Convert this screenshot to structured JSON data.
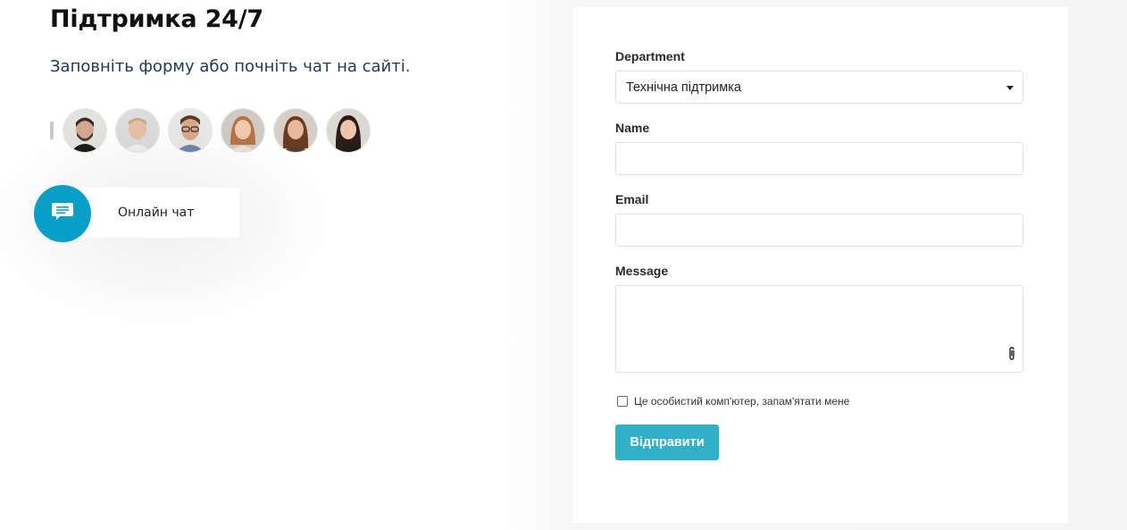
{
  "support": {
    "title": "Підтримка 24/7",
    "subtitle": "Заповніть форму або почніть чат на сайті."
  },
  "chat_widget": {
    "label": "Онлайн чат",
    "icon": "chat-icon",
    "color": "#0a9fc6"
  },
  "avatars": [
    {
      "name": "avatar-agent-1"
    },
    {
      "name": "avatar-agent-2"
    },
    {
      "name": "avatar-agent-3"
    },
    {
      "name": "avatar-agent-4"
    },
    {
      "name": "avatar-agent-5"
    },
    {
      "name": "avatar-agent-6"
    }
  ],
  "form": {
    "department_label": "Department",
    "department_value": "Технічна підтримка",
    "name_label": "Name",
    "name_value": "",
    "email_label": "Email",
    "email_value": "",
    "message_label": "Message",
    "message_value": "",
    "attach_icon": "paperclip-icon",
    "remember_label": "Це особистий комп'ютер, запам'ятати мене",
    "remember_checked": false,
    "submit_label": "Відправити",
    "submit_color": "#31b0c9"
  }
}
